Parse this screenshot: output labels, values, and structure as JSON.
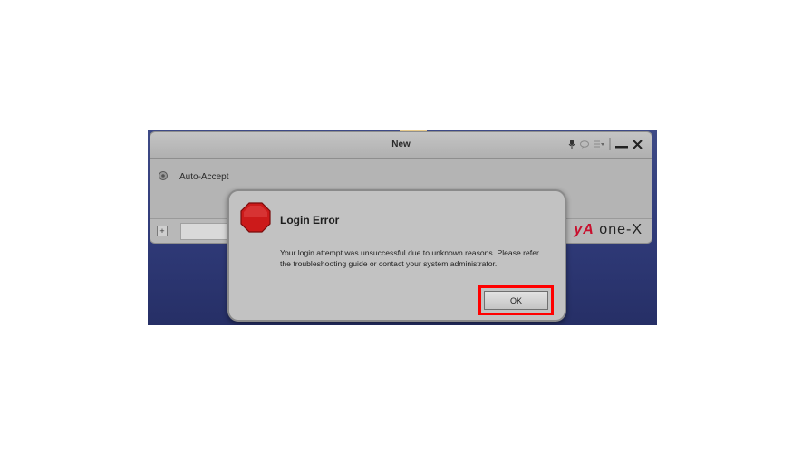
{
  "app_window": {
    "title": "New",
    "auto_accept_label": "Auto-Accept",
    "plus_glyph": "+",
    "brand": {
      "prefix": "yA",
      "suffix": "one-X"
    }
  },
  "dialog": {
    "title": "Login Error",
    "message": "Your login attempt was unsuccessful due to unknown reasons. Please refer the troubleshooting guide or contact your system administrator.",
    "ok_label": "OK",
    "icon": "stop-icon"
  },
  "colors": {
    "stop_red": "#cc1a1a",
    "highlight_red": "#ff0000",
    "desktop_blue": "#2f3a78",
    "brand_red": "#c8102e"
  }
}
